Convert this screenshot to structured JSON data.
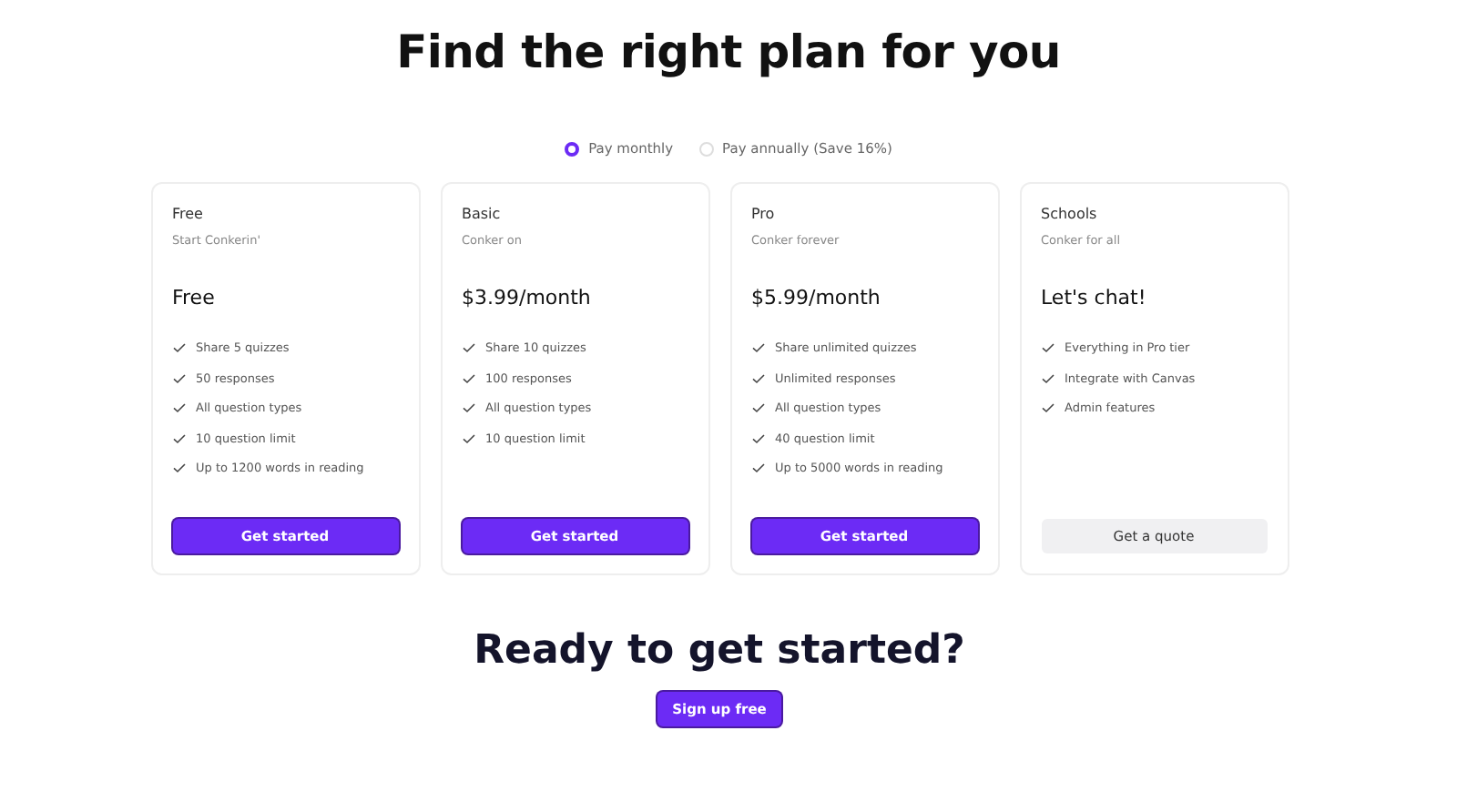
{
  "heading": "Find the right plan for you",
  "billing": [
    {
      "label": "Pay monthly",
      "selected": true
    },
    {
      "label": "Pay annually (Save 16%)",
      "selected": false
    }
  ],
  "plans": [
    {
      "name": "Free",
      "tagline": "Start Conkerin'",
      "price": "Free",
      "features": [
        "Share 5 quizzes",
        "50 responses",
        "All question types",
        "10 question limit",
        "Up to 1200 words in reading"
      ],
      "button": {
        "label": "Get started",
        "kind": "primary"
      }
    },
    {
      "name": "Basic",
      "tagline": "Conker on",
      "price": "$3.99/month",
      "features": [
        "Share 10 quizzes",
        "100 responses",
        "All question types",
        "10 question limit"
      ],
      "button": {
        "label": "Get started",
        "kind": "primary"
      }
    },
    {
      "name": "Pro",
      "tagline": "Conker forever",
      "price": "$5.99/month",
      "features": [
        "Share unlimited quizzes",
        "Unlimited responses",
        "All question types",
        "40 question limit",
        "Up to 5000 words in reading"
      ],
      "button": {
        "label": "Get started",
        "kind": "primary"
      }
    },
    {
      "name": "Schools",
      "tagline": "Conker for all",
      "price": "Let's chat!",
      "features": [
        "Everything in Pro tier",
        "Integrate with Canvas",
        "Admin features"
      ],
      "button": {
        "label": "Get a quote",
        "kind": "secondary"
      }
    }
  ],
  "cta": {
    "heading": "Ready to get started?",
    "button": "Sign up free"
  }
}
